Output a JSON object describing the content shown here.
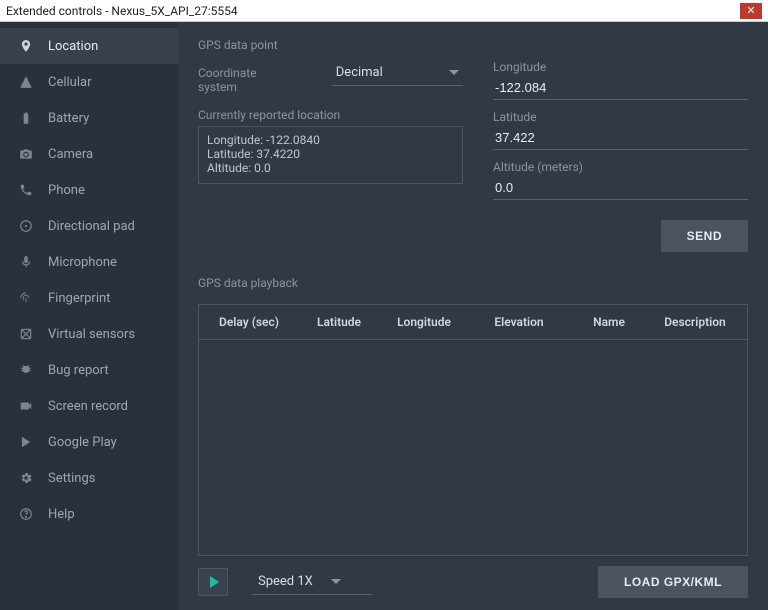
{
  "window": {
    "title": "Extended controls - Nexus_5X_API_27:5554"
  },
  "sidebar": {
    "items": [
      {
        "label": "Location",
        "icon": "location-pin-icon",
        "selected": true
      },
      {
        "label": "Cellular",
        "icon": "signal-icon",
        "selected": false
      },
      {
        "label": "Battery",
        "icon": "battery-icon",
        "selected": false
      },
      {
        "label": "Camera",
        "icon": "camera-icon",
        "selected": false
      },
      {
        "label": "Phone",
        "icon": "phone-icon",
        "selected": false
      },
      {
        "label": "Directional pad",
        "icon": "dpad-icon",
        "selected": false
      },
      {
        "label": "Microphone",
        "icon": "microphone-icon",
        "selected": false
      },
      {
        "label": "Fingerprint",
        "icon": "fingerprint-icon",
        "selected": false
      },
      {
        "label": "Virtual sensors",
        "icon": "sensors-icon",
        "selected": false
      },
      {
        "label": "Bug report",
        "icon": "bug-icon",
        "selected": false
      },
      {
        "label": "Screen record",
        "icon": "record-icon",
        "selected": false
      },
      {
        "label": "Google Play",
        "icon": "play-store-icon",
        "selected": false
      },
      {
        "label": "Settings",
        "icon": "gear-icon",
        "selected": false
      },
      {
        "label": "Help",
        "icon": "help-icon",
        "selected": false
      }
    ]
  },
  "gps": {
    "section_title": "GPS data point",
    "coord_label": "Coordinate system",
    "coord_value": "Decimal",
    "longitude_label": "Longitude",
    "longitude_value": "-122.084",
    "latitude_label": "Latitude",
    "latitude_value": "37.422",
    "altitude_label": "Altitude (meters)",
    "altitude_value": "0.0",
    "reported_label": "Currently reported location",
    "reported_lines": {
      "l1": "Longitude: -122.0840",
      "l2": "Latitude: 37.4220",
      "l3": "Altitude: 0.0"
    },
    "send_label": "SEND"
  },
  "playback": {
    "section_title": "GPS data playback",
    "columns": {
      "delay": "Delay (sec)",
      "latitude": "Latitude",
      "longitude": "Longitude",
      "elevation": "Elevation",
      "name": "Name",
      "description": "Description"
    },
    "speed_label": "Speed 1X",
    "load_label": "LOAD GPX/KML"
  }
}
